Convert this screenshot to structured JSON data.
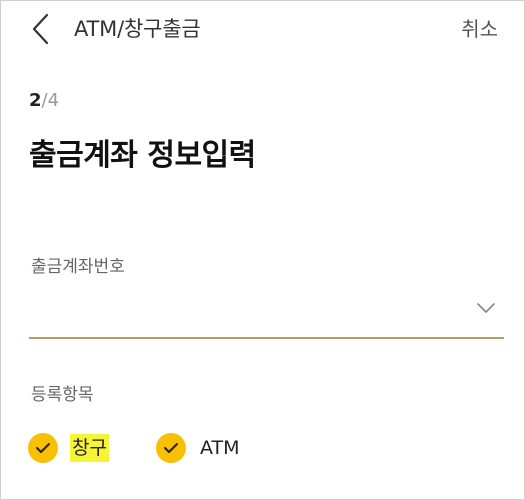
{
  "header": {
    "title": "ATM/창구출금",
    "cancel_label": "취소"
  },
  "step": {
    "current": "2",
    "separator": "/",
    "total": "4"
  },
  "page_title": "출금계좌 정보입력",
  "account_field": {
    "label": "출금계좌번호",
    "value": ""
  },
  "registration": {
    "label": "등록항목",
    "options": [
      {
        "label": "창구",
        "checked": true,
        "highlighted": true
      },
      {
        "label": "ATM",
        "checked": true,
        "highlighted": false
      }
    ]
  },
  "colors": {
    "accent": "#f7c000",
    "underline": "#b59a63",
    "highlight": "#f7f437"
  },
  "icons": {
    "back": "chevron-left-icon",
    "dropdown": "chevron-down-icon",
    "check": "check-icon"
  }
}
